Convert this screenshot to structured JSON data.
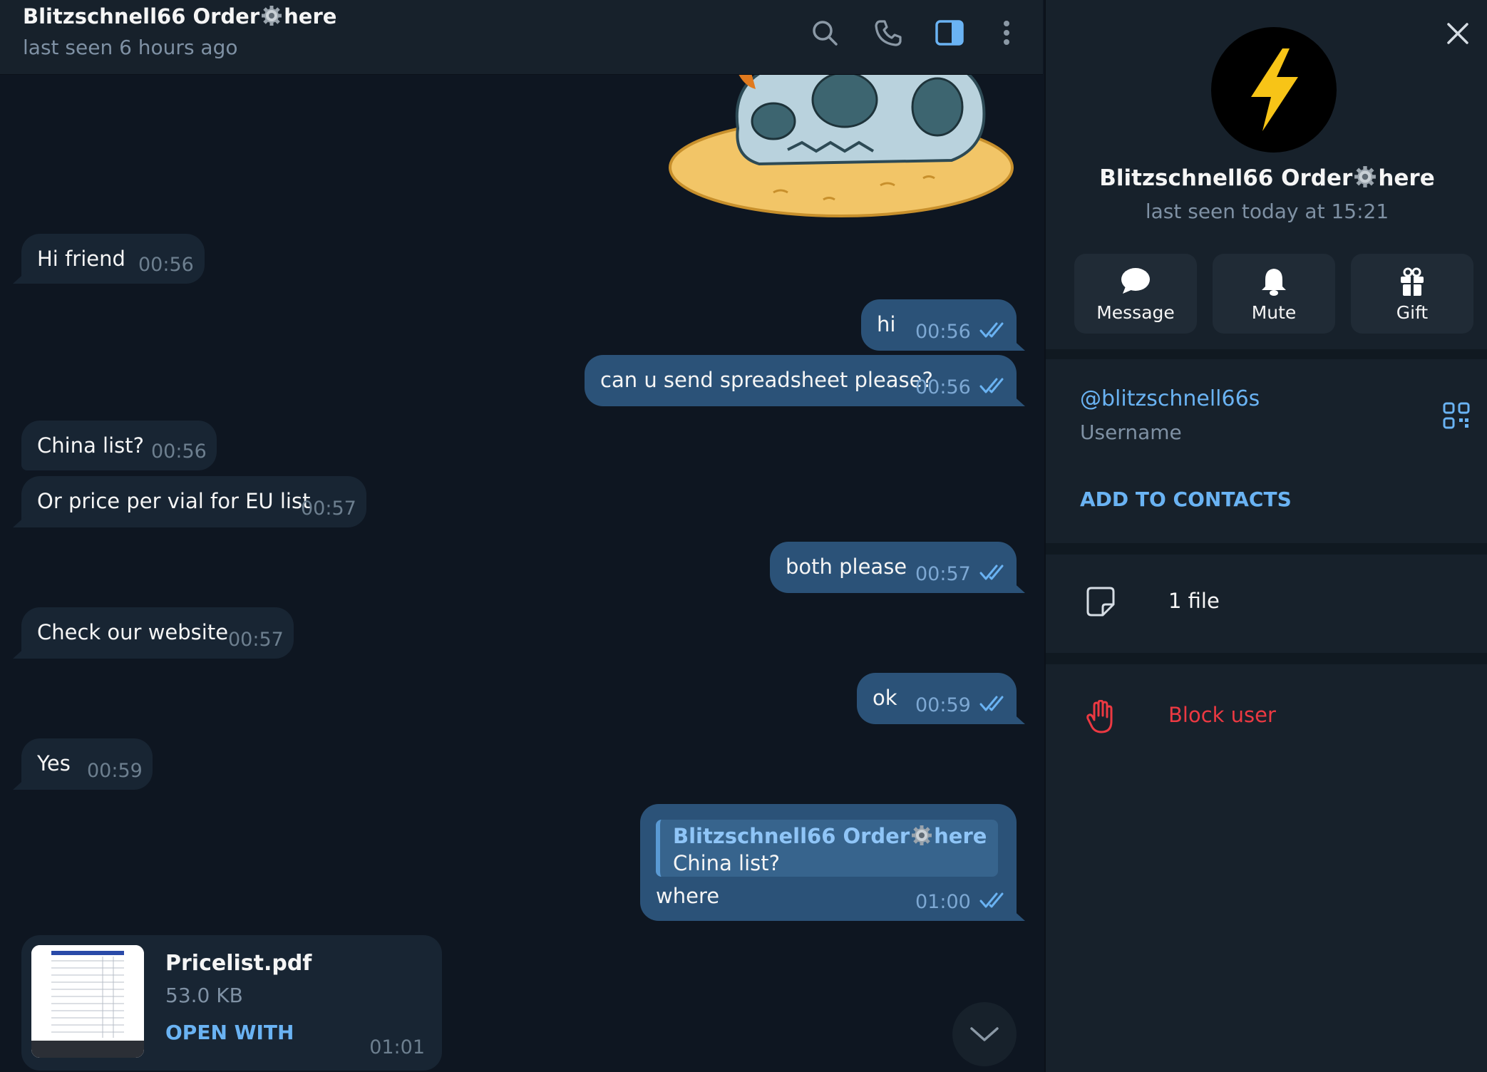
{
  "chat": {
    "title_prefix": "Blitzschnell66 Order",
    "title_suffix": "here",
    "status": "last seen 6 hours ago"
  },
  "messages": [
    {
      "dir": "in",
      "text": "Hi friend",
      "time": "00:56"
    },
    {
      "dir": "out",
      "text": "hi",
      "time": "00:56",
      "read": true
    },
    {
      "dir": "out",
      "text": "can u send spreadsheet please?",
      "time": "00:56",
      "read": true
    },
    {
      "dir": "in",
      "text": "China list?",
      "time": "00:56"
    },
    {
      "dir": "in",
      "text": "Or price per vial for EU list",
      "time": "00:57"
    },
    {
      "dir": "out",
      "text": "both please",
      "time": "00:57",
      "read": true
    },
    {
      "dir": "in",
      "text": "Check our website",
      "time": "00:57"
    },
    {
      "dir": "out",
      "text": "ok",
      "time": "00:59",
      "read": true
    },
    {
      "dir": "in",
      "text": "Yes",
      "time": "00:59"
    }
  ],
  "reply": {
    "quoted_name_prefix": "Blitzschnell66 Order",
    "quoted_name_suffix": "here",
    "quoted_text": "China list?",
    "text": "where",
    "time": "01:00"
  },
  "file": {
    "name": "Pricelist.pdf",
    "size": "53.0 KB",
    "action": "OPEN WITH",
    "time": "01:01"
  },
  "profile": {
    "name_prefix": "Blitzschnell66 Order",
    "name_suffix": "here",
    "status": "last seen today at 15:21",
    "actions": [
      {
        "label": "Message",
        "icon": "chat-bubble-icon"
      },
      {
        "label": "Mute",
        "icon": "bell-icon"
      },
      {
        "label": "Gift",
        "icon": "gift-icon"
      }
    ],
    "username": "@blitzschnell66s",
    "username_label": "Username",
    "add_contacts": "ADD TO CONTACTS",
    "files": "1 file",
    "block": "Block user"
  },
  "colors": {
    "accent": "#6ab3f3",
    "outgoing_bubble": "#2b5278",
    "incoming_bubble": "#182533",
    "danger": "#ec3942",
    "avatar_bolt": "#f7c417"
  }
}
